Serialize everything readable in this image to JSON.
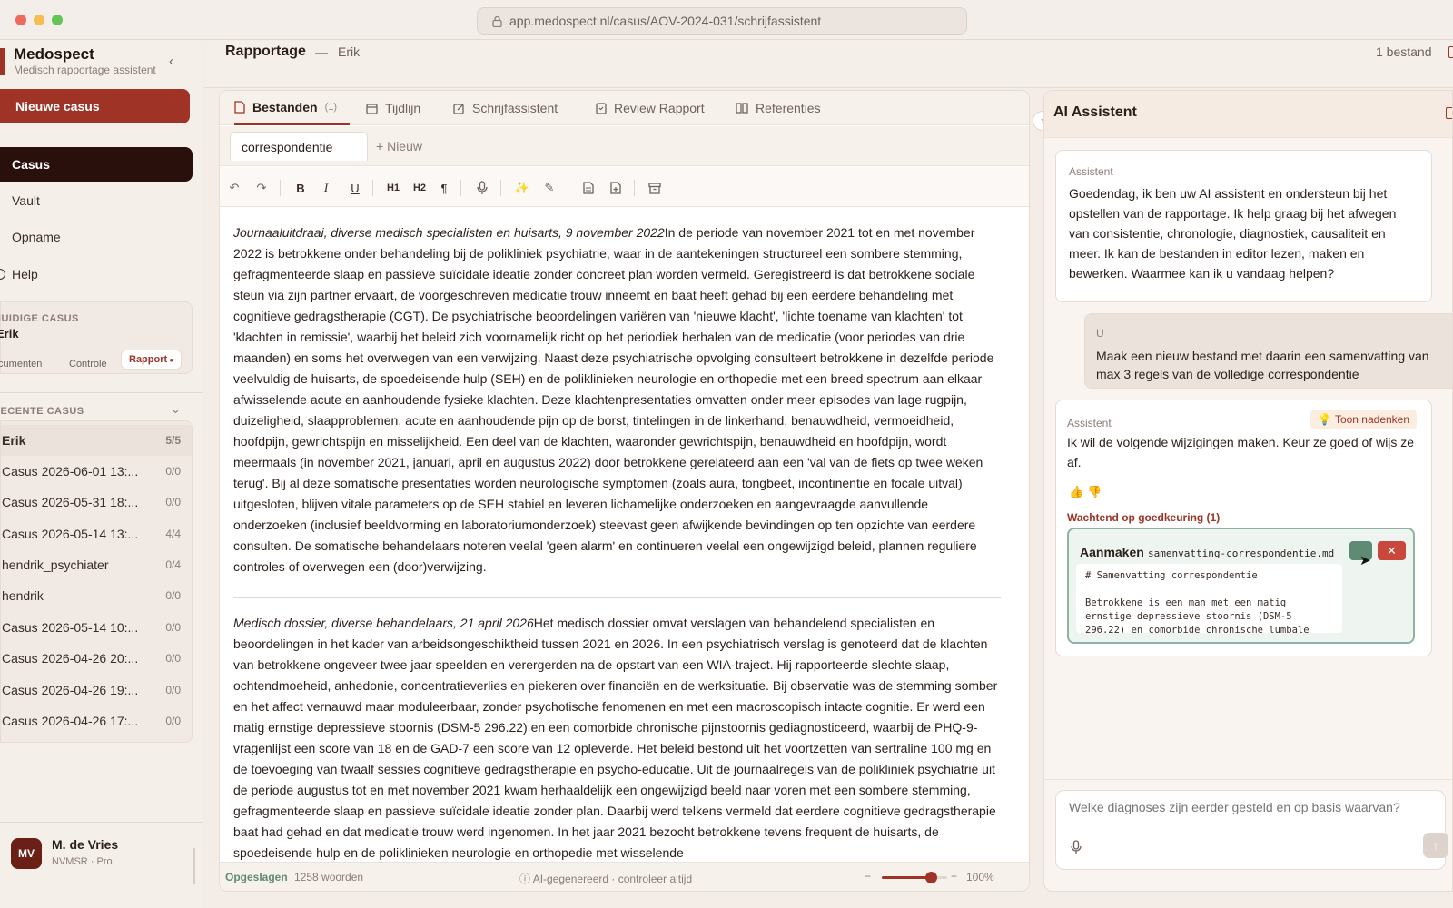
{
  "browser": {
    "url": "app.medospect.nl/casus/AOV-2024-031/schrijfassistent"
  },
  "sidebar": {
    "app_name": "Medospect",
    "app_subtitle": "Medisch rapportage assistent",
    "new_case_label": "Nieuwe casus",
    "nav": [
      {
        "label": "Casus",
        "icon": "briefcase-icon"
      },
      {
        "label": "Vault",
        "icon": "vault-icon"
      },
      {
        "label": "Opname",
        "icon": "mic-icon"
      },
      {
        "label": "Help",
        "icon": "help-icon"
      }
    ],
    "current_case": {
      "section_label": "HUIDIGE CASUS",
      "name": "Erik",
      "segments": [
        "Documenten",
        "Controle",
        "Rapport"
      ]
    },
    "recent": {
      "section_label": "RECENTE CASUS",
      "items": [
        {
          "name": "Erik",
          "count": "5/5"
        },
        {
          "name": "Casus 2026-06-01 13:...",
          "count": "0/0"
        },
        {
          "name": "Casus 2026-05-31 18:...",
          "count": "0/0"
        },
        {
          "name": "Casus 2026-05-14 13:...",
          "count": "4/4"
        },
        {
          "name": "hendrik_psychiater",
          "count": "0/4"
        },
        {
          "name": "hendrik",
          "count": "0/0"
        },
        {
          "name": "Casus 2026-05-14 10:...",
          "count": "0/0"
        },
        {
          "name": "Casus 2026-04-26 20:...",
          "count": "0/0"
        },
        {
          "name": "Casus 2026-04-26 19:...",
          "count": "0/0"
        },
        {
          "name": "Casus 2026-04-26 17:...",
          "count": "0/0"
        }
      ]
    },
    "user": {
      "initials": "MV",
      "name": "M. de Vries",
      "role": "NVMSR · Pro"
    }
  },
  "header": {
    "title": "Rapportage",
    "separator": "—",
    "case_name": "Erik",
    "file_count": "1 bestand"
  },
  "editor": {
    "tabs": [
      {
        "label": "Bestanden",
        "badge": "(1)"
      },
      {
        "label": "Tijdlijn",
        "badge": ""
      },
      {
        "label": "Schrijfassistent",
        "badge": ""
      },
      {
        "label": "Review Rapport",
        "badge": ""
      },
      {
        "label": "Referenties",
        "badge": ""
      }
    ],
    "file_tab": "correspondentie",
    "new_file_label": "Nieuw",
    "toolbar": {
      "h1": "H1",
      "h2": "H2",
      "para": "¶"
    },
    "paragraphs": [
      {
        "heading": "Journaaluitdraai, diverse medisch specialisten en huisarts, 9 november 2022",
        "body": "In de periode van november 2021 tot en met november 2022 is betrokkene onder behandeling bij de polikliniek psychiatrie, waar in de aantekeningen structureel een sombere stemming, gefragmenteerde slaap en passieve suïcidale ideatie zonder concreet plan worden vermeld. Geregistreerd is dat betrokkene sociale steun via zijn partner ervaart, de voorgeschreven medicatie trouw inneemt en baat heeft gehad bij een eerdere behandeling met cognitieve gedragstherapie (CGT). De psychiatrische beoordelingen variëren van 'nieuwe klacht', 'lichte toename van klachten' tot 'klachten in remissie', waarbij het beleid zich voornamelijk richt op het periodiek herhalen van de medicatie (voor periodes van drie maanden) en soms het overwegen van een verwijzing. Naast deze psychiatrische opvolging consulteert betrokkene in dezelfde periode veelvuldig de huisarts, de spoedeisende hulp (SEH) en de poliklinieken neurologie en orthopedie met een breed spectrum aan elkaar afwisselende acute en aanhoudende fysieke klachten. Deze klachtenpresentaties omvatten onder meer episodes van lage rugpijn, duizeligheid, slaapproblemen, acute en aanhoudende pijn op de borst, tintelingen in de linkerhand, benauwdheid, vermoeidheid, hoofdpijn, gewrichtspijn en misselijkheid. Een deel van de klachten, waaronder gewrichtspijn, benauwdheid en hoofdpijn, wordt meermaals (in november 2021, januari, april en augustus 2022) door betrokkene gerelateerd aan een 'val van de fiets op twee weken terug'. Bij al deze somatische presentaties worden neurologische symptomen (zoals aura, tongbeet, incontinentie en focale uitval) uitgesloten, blijven vitale parameters op de SEH stabiel en leveren lichamelijke onderzoeken en aangevraagde aanvullende onderzoeken (inclusief beeldvorming en laboratoriumonderzoek) steevast geen afwijkende bevindingen op ten opzichte van eerdere consulten. De somatische behandelaars noteren veelal 'geen alarm' en continueren veelal een ongewijzigd beleid, plannen reguliere controles of overwegen een (door)verwijzing."
      },
      {
        "heading": "Medisch dossier, diverse behandelaars, 21 april 2026",
        "body": "Het medisch dossier omvat verslagen van behandelend specialisten en beoordelingen in het kader van arbeidsongeschiktheid tussen 2021 en 2026. In een psychiatrisch verslag is genoteerd dat de klachten van betrokkene ongeveer twee jaar speelden en verergerden na de opstart van een WIA-traject. Hij rapporteerde slechte slaap, ochtendmoeheid, anhedonie, concentratieverlies en piekeren over financiën en de werksituatie. Bij observatie was de stemming somber en het affect vernauwd maar moduleerbaar, zonder psychotische fenomenen en met een macroscopisch intacte cognitie. Er werd een matig ernstige depressieve stoornis (DSM-5 296.22) en een comorbide chronische pijnstoornis gediagnosticeerd, waarbij de PHQ-9-vragenlijst een score van 18 en de GAD-7 een score van 12 opleverde. Het beleid bestond uit het voortzetten van sertraline 100 mg en de toevoeging van twaalf sessies cognitieve gedragstherapie en psycho-educatie. Uit de journaalregels van de polikliniek psychiatrie uit de periode augustus tot en met november 2021 kwam herhaaldelijk een ongewijzigd beeld naar voren met een sombere stemming, gefragmenteerde slaap en passieve suïcidale ideatie zonder plan. Daarbij werd telkens vermeld dat eerdere cognitieve gedragstherapie baat had gehad en dat medicatie trouw werd ingenomen. In het jaar 2021 bezocht betrokkene tevens frequent de huisarts, de spoedeisende hulp en de poliklinieken neurologie en orthopedie met wisselende"
      }
    ],
    "status": {
      "saved": "Opgeslagen",
      "words": "1258 woorden",
      "notice": "AI-gegenereerd · controleer altijd",
      "zoom_minus": "−",
      "zoom_plus": "+",
      "zoom": "100%",
      "zoom_level": 0.75
    }
  },
  "ai": {
    "title": "AI Assistent",
    "messages": [
      {
        "who": "Assistent",
        "text": "Goedendag, ik ben uw AI assistent en ondersteun bij het opstellen van de rapportage. Ik help graag bij het afwegen van consistentie, chronologie, diagnostiek, causaliteit en meer. Ik kan de bestanden in editor lezen, maken en bewerken. Waarmee kan ik u vandaag helpen?"
      },
      {
        "who": "U",
        "text": "Maak een nieuw bestand met daarin een samenvatting van max 3 regels van de volledige correspondentie"
      },
      {
        "who": "Assistent",
        "text": "Ik wil de volgende wijzigingen maken. Keur ze goed of wijs ze af.",
        "think_label": "Toon nadenken"
      }
    ],
    "pending_label": "Wachtend op goedkeuring (1)",
    "change": {
      "action": "Aanmaken",
      "filename": "samenvatting-correspondentie.md",
      "preview": [
        "# Samenvatting correspondentie",
        "",
        "Betrokkene is een man met een matig",
        "ernstige depressieve stoornis (DSM-5",
        "296.22) en comorbide chronische lumbale"
      ]
    },
    "input_placeholder": "Welke diagnoses zijn eerder gesteld en op basis waarvan?"
  },
  "colors": {
    "accent": "#9e3326",
    "dark": "#2a100c",
    "approve": "#5f8a74",
    "reject": "#c9473d"
  }
}
